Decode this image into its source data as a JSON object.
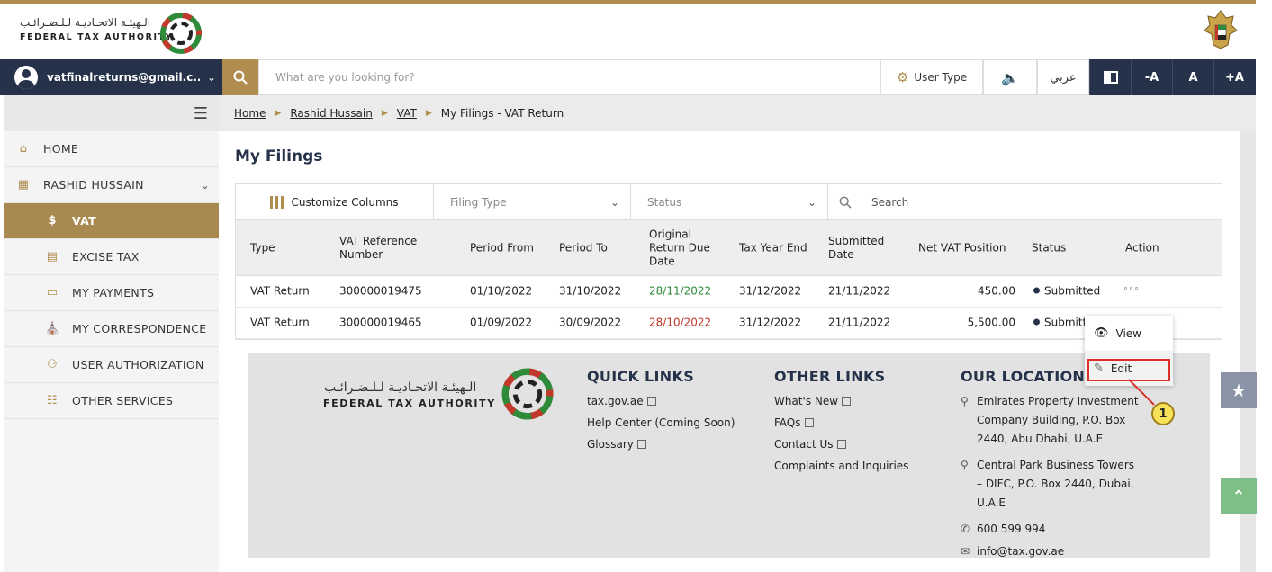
{
  "brand": {
    "name_ar": "الـهيئـة الاتحـاديـة لـلـضـرائـب",
    "name_en": "FEDERAL TAX AUTHORITY"
  },
  "nav": {
    "user_email": "vatfinalreturns@gmail.c...",
    "search_placeholder": "What are you looking for?",
    "user_type_label": "User Type",
    "arabic_label": "عربي",
    "font_decrease": "-A",
    "font_reset": "A",
    "font_increase": "+A"
  },
  "sidebar": {
    "items": [
      {
        "label": "HOME",
        "icon": "home-icon"
      },
      {
        "label": "RASHID HUSSAIN",
        "icon": "grid-icon"
      },
      {
        "label": "VAT",
        "icon": "money-bag-icon"
      },
      {
        "label": "EXCISE TAX",
        "icon": "excise-icon"
      },
      {
        "label": "MY PAYMENTS",
        "icon": "card-icon"
      },
      {
        "label": "MY CORRESPONDENCE",
        "icon": "building-icon"
      },
      {
        "label": "USER AUTHORIZATION",
        "icon": "user-key-icon"
      },
      {
        "label": "OTHER SERVICES",
        "icon": "clipboard-icon"
      }
    ]
  },
  "breadcrumb": {
    "items": [
      "Home",
      "Rashid Hussain",
      "VAT",
      "My Filings - VAT Return"
    ]
  },
  "page": {
    "title": "My Filings"
  },
  "toolbar": {
    "customize_columns": "Customize Columns",
    "filing_type": "Filing Type",
    "status": "Status",
    "search": "Search"
  },
  "table": {
    "headers": {
      "type": "Type",
      "vat_ref": "VAT Reference Number",
      "period_from": "Period From",
      "period_to": "Period To",
      "original_due": "Original Return Due Date",
      "tax_year_end": "Tax Year End",
      "submitted_date": "Submitted Date",
      "net_vat": "Net VAT Position",
      "status": "Status",
      "action": "Action"
    },
    "rows": [
      {
        "type": "VAT Return",
        "vat_ref": "300000019475",
        "period_from": "01/10/2022",
        "period_to": "31/10/2022",
        "original_due": "28/11/2022",
        "due_color": "#2e8b3a",
        "tax_year_end": "31/12/2022",
        "submitted_date": "21/11/2022",
        "net_vat": "450.00",
        "status": "Submitted",
        "action": "°°°"
      },
      {
        "type": "VAT Return",
        "vat_ref": "300000019465",
        "period_from": "01/09/2022",
        "period_to": "30/09/2022",
        "original_due": "28/10/2022",
        "due_color": "#c0392b",
        "tax_year_end": "31/12/2022",
        "submitted_date": "21/11/2022",
        "net_vat": "5,500.00",
        "status": "Submitt",
        "action": ""
      }
    ]
  },
  "action_menu": {
    "view": "View",
    "edit": "Edit",
    "callout_number": "1"
  },
  "footer": {
    "quick_links": {
      "title": "QUICK LINKS",
      "items": [
        "tax.gov.ae",
        "Help Center (Coming Soon)",
        "Glossary"
      ]
    },
    "other_links": {
      "title": "OTHER LINKS",
      "items": [
        "What's New",
        "FAQs",
        "Contact Us",
        "Complaints and Inquiries"
      ]
    },
    "location": {
      "title": "OUR LOCATION",
      "address1": [
        "Emirates Property Investment",
        "Company Building, P.O. Box",
        "2440, Abu Dhabi, U.A.E"
      ],
      "address2": [
        "Central Park Business Towers",
        "– DIFC, P.O. Box 2440, Dubai,",
        "U.A.E"
      ],
      "phone": "600 599 994",
      "email": "info@tax.gov.ae"
    }
  },
  "colors": {
    "navy": "#26324a",
    "gold": "#b08d4f",
    "overdue": "#c0392b",
    "ontime": "#2e8b3a"
  }
}
